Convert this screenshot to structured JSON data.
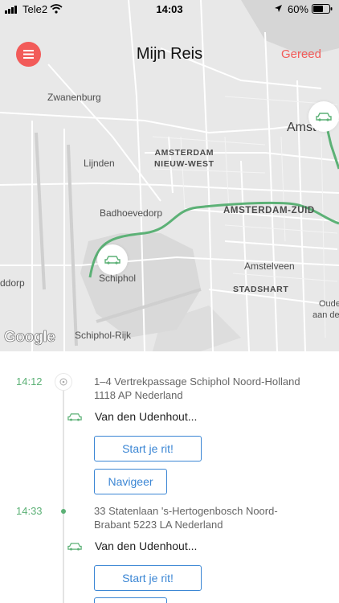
{
  "status_bar": {
    "carrier": "Tele2",
    "time": "14:03",
    "battery": "60%"
  },
  "header": {
    "title": "Mijn Reis",
    "done_label": "Gereed"
  },
  "map": {
    "labels": {
      "zwanenburg": "Zwanenburg",
      "lijnden": "Lijnden",
      "badhoevedorp": "Badhoevedorp",
      "schiphol": "Schiphol",
      "schiphol_rijk": "Schiphol-Rijk",
      "hoofddorp": "ddorp",
      "amsterdam_nw_1": "AMSTERDAM",
      "amsterdam_nw_2": "NIEUW-WEST",
      "amsterdam_zuid": "AMSTERDAM-ZUID",
      "amstelveen": "Amstelveen",
      "stadshart": "STADSHART",
      "amsterdam": "Amster",
      "oude_1": "Oude",
      "oude_2": "aan de"
    },
    "attribution": "Google",
    "route_color": "#5cb176"
  },
  "itinerary": {
    "stops": [
      {
        "time": "14:12",
        "address_line1": "1–4 Vertrekpassage Schiphol Noord-Holland",
        "address_line2": "1118 AP Nederland",
        "driver": "Van den Udenhout...",
        "start_label": "Start je rit!",
        "navigate_label": "Navigeer"
      },
      {
        "time": "14:33",
        "address_line1": "33 Statenlaan 's-Hertogenbosch Noord-",
        "address_line2": "Brabant 5223 LA Nederland",
        "driver": "Van den Udenhout...",
        "start_label": "Start je rit!",
        "navigate_label": "Navigeer"
      }
    ]
  },
  "colors": {
    "accent_red": "#f25b59",
    "accent_green": "#5cb176",
    "accent_blue": "#3b86d4"
  }
}
